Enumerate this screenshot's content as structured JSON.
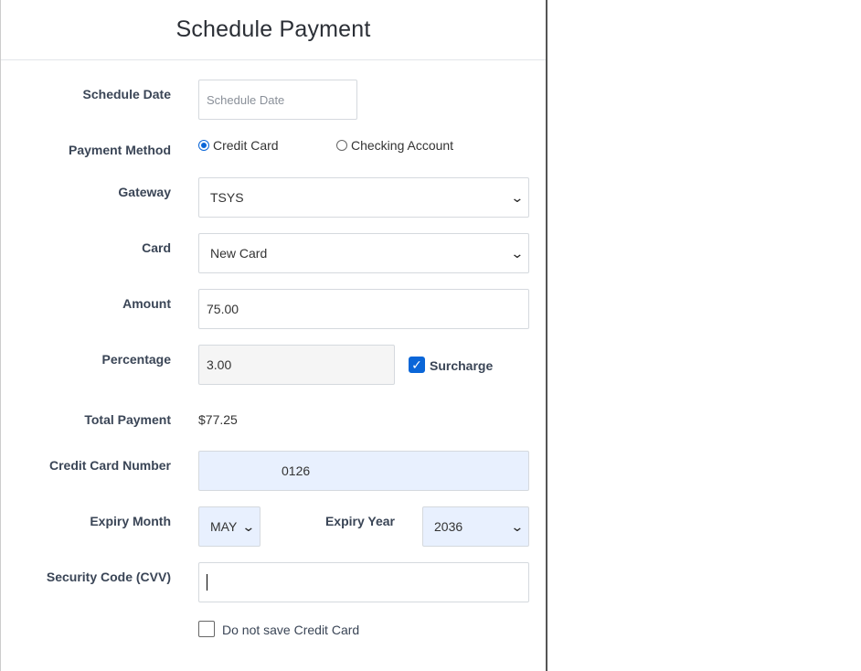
{
  "modal": {
    "title": "Schedule Payment"
  },
  "form": {
    "schedule_date": {
      "label": "Schedule Date",
      "placeholder": "Schedule Date",
      "value": ""
    },
    "payment_method": {
      "label": "Payment Method",
      "options": [
        "Credit Card",
        "Checking Account"
      ],
      "selected": "Credit Card"
    },
    "gateway": {
      "label": "Gateway",
      "value": "TSYS"
    },
    "card": {
      "label": "Card",
      "value": "New Card"
    },
    "amount": {
      "label": "Amount",
      "value": "75.00"
    },
    "percentage": {
      "label": "Percentage",
      "value": "3.00"
    },
    "surcharge": {
      "label": "Surcharge",
      "checked": true
    },
    "total_payment": {
      "label": "Total Payment",
      "value": "$77.25"
    },
    "credit_card_number": {
      "label": "Credit Card Number",
      "value": "0126"
    },
    "expiry_month": {
      "label": "Expiry Month",
      "value": "MAY"
    },
    "expiry_year": {
      "label": "Expiry Year",
      "value": "2036"
    },
    "security_code": {
      "label": "Security Code (CVV)",
      "value": ""
    },
    "do_not_save": {
      "label": "Do not save Credit Card",
      "checked": false
    }
  },
  "icons": {
    "chevron": "chevron-down-icon",
    "check": "checkmark-icon"
  },
  "colors": {
    "accent": "#0a66d8",
    "autofill_bg": "#e8f0fe",
    "readonly_bg": "#f5f5f5"
  }
}
